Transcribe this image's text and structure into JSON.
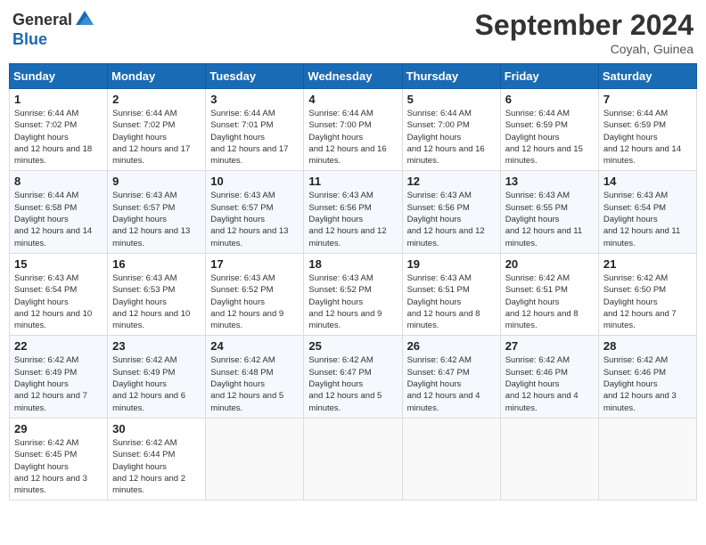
{
  "header": {
    "logo_general": "General",
    "logo_blue": "Blue",
    "month_title": "September 2024",
    "location": "Coyah, Guinea"
  },
  "weekdays": [
    "Sunday",
    "Monday",
    "Tuesday",
    "Wednesday",
    "Thursday",
    "Friday",
    "Saturday"
  ],
  "weeks": [
    [
      {
        "day": "1",
        "sunrise": "6:44 AM",
        "sunset": "7:02 PM",
        "daylight": "12 hours and 18 minutes."
      },
      {
        "day": "2",
        "sunrise": "6:44 AM",
        "sunset": "7:02 PM",
        "daylight": "12 hours and 17 minutes."
      },
      {
        "day": "3",
        "sunrise": "6:44 AM",
        "sunset": "7:01 PM",
        "daylight": "12 hours and 17 minutes."
      },
      {
        "day": "4",
        "sunrise": "6:44 AM",
        "sunset": "7:00 PM",
        "daylight": "12 hours and 16 minutes."
      },
      {
        "day": "5",
        "sunrise": "6:44 AM",
        "sunset": "7:00 PM",
        "daylight": "12 hours and 16 minutes."
      },
      {
        "day": "6",
        "sunrise": "6:44 AM",
        "sunset": "6:59 PM",
        "daylight": "12 hours and 15 minutes."
      },
      {
        "day": "7",
        "sunrise": "6:44 AM",
        "sunset": "6:59 PM",
        "daylight": "12 hours and 14 minutes."
      }
    ],
    [
      {
        "day": "8",
        "sunrise": "6:44 AM",
        "sunset": "6:58 PM",
        "daylight": "12 hours and 14 minutes."
      },
      {
        "day": "9",
        "sunrise": "6:43 AM",
        "sunset": "6:57 PM",
        "daylight": "12 hours and 13 minutes."
      },
      {
        "day": "10",
        "sunrise": "6:43 AM",
        "sunset": "6:57 PM",
        "daylight": "12 hours and 13 minutes."
      },
      {
        "day": "11",
        "sunrise": "6:43 AM",
        "sunset": "6:56 PM",
        "daylight": "12 hours and 12 minutes."
      },
      {
        "day": "12",
        "sunrise": "6:43 AM",
        "sunset": "6:56 PM",
        "daylight": "12 hours and 12 minutes."
      },
      {
        "day": "13",
        "sunrise": "6:43 AM",
        "sunset": "6:55 PM",
        "daylight": "12 hours and 11 minutes."
      },
      {
        "day": "14",
        "sunrise": "6:43 AM",
        "sunset": "6:54 PM",
        "daylight": "12 hours and 11 minutes."
      }
    ],
    [
      {
        "day": "15",
        "sunrise": "6:43 AM",
        "sunset": "6:54 PM",
        "daylight": "12 hours and 10 minutes."
      },
      {
        "day": "16",
        "sunrise": "6:43 AM",
        "sunset": "6:53 PM",
        "daylight": "12 hours and 10 minutes."
      },
      {
        "day": "17",
        "sunrise": "6:43 AM",
        "sunset": "6:52 PM",
        "daylight": "12 hours and 9 minutes."
      },
      {
        "day": "18",
        "sunrise": "6:43 AM",
        "sunset": "6:52 PM",
        "daylight": "12 hours and 9 minutes."
      },
      {
        "day": "19",
        "sunrise": "6:43 AM",
        "sunset": "6:51 PM",
        "daylight": "12 hours and 8 minutes."
      },
      {
        "day": "20",
        "sunrise": "6:42 AM",
        "sunset": "6:51 PM",
        "daylight": "12 hours and 8 minutes."
      },
      {
        "day": "21",
        "sunrise": "6:42 AM",
        "sunset": "6:50 PM",
        "daylight": "12 hours and 7 minutes."
      }
    ],
    [
      {
        "day": "22",
        "sunrise": "6:42 AM",
        "sunset": "6:49 PM",
        "daylight": "12 hours and 7 minutes."
      },
      {
        "day": "23",
        "sunrise": "6:42 AM",
        "sunset": "6:49 PM",
        "daylight": "12 hours and 6 minutes."
      },
      {
        "day": "24",
        "sunrise": "6:42 AM",
        "sunset": "6:48 PM",
        "daylight": "12 hours and 5 minutes."
      },
      {
        "day": "25",
        "sunrise": "6:42 AM",
        "sunset": "6:47 PM",
        "daylight": "12 hours and 5 minutes."
      },
      {
        "day": "26",
        "sunrise": "6:42 AM",
        "sunset": "6:47 PM",
        "daylight": "12 hours and 4 minutes."
      },
      {
        "day": "27",
        "sunrise": "6:42 AM",
        "sunset": "6:46 PM",
        "daylight": "12 hours and 4 minutes."
      },
      {
        "day": "28",
        "sunrise": "6:42 AM",
        "sunset": "6:46 PM",
        "daylight": "12 hours and 3 minutes."
      }
    ],
    [
      {
        "day": "29",
        "sunrise": "6:42 AM",
        "sunset": "6:45 PM",
        "daylight": "12 hours and 3 minutes."
      },
      {
        "day": "30",
        "sunrise": "6:42 AM",
        "sunset": "6:44 PM",
        "daylight": "12 hours and 2 minutes."
      },
      null,
      null,
      null,
      null,
      null
    ]
  ]
}
